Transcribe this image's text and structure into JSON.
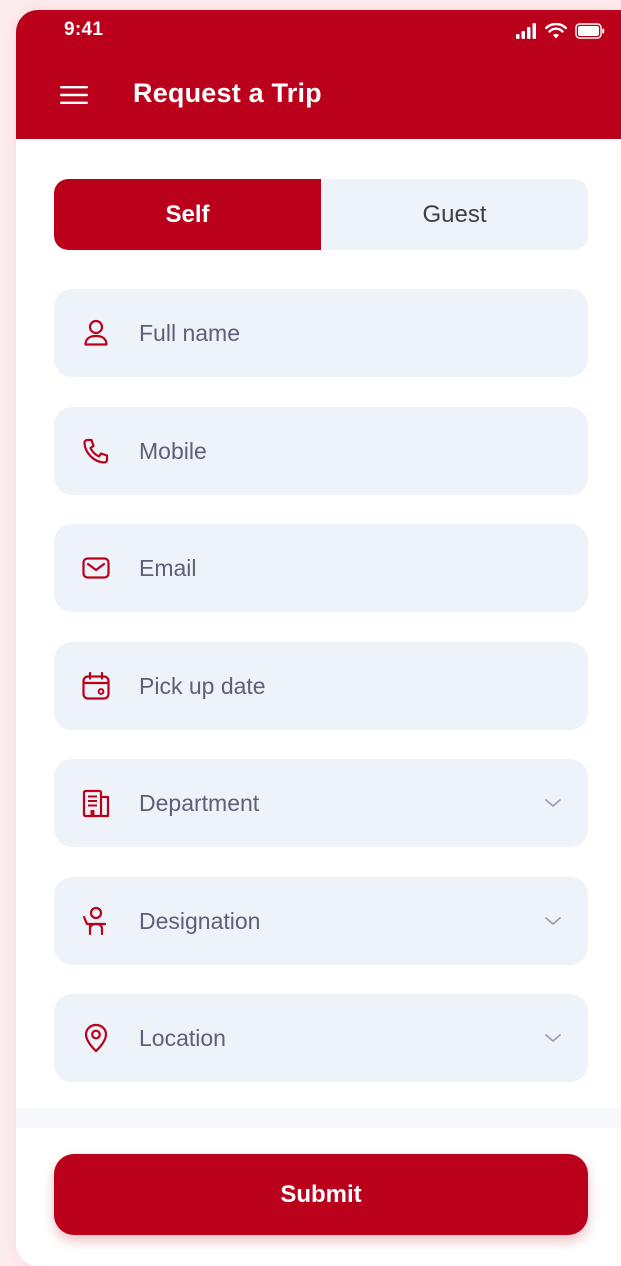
{
  "status_bar": {
    "time": "9:41"
  },
  "header": {
    "title": "Request a Trip"
  },
  "tabs": [
    {
      "label": "Self",
      "active": true
    },
    {
      "label": "Guest",
      "active": false
    }
  ],
  "fields": [
    {
      "placeholder": "Full name",
      "icon": "user-icon",
      "dropdown": false
    },
    {
      "placeholder": "Mobile",
      "icon": "phone-icon",
      "dropdown": false
    },
    {
      "placeholder": "Email",
      "icon": "mail-icon",
      "dropdown": false
    },
    {
      "placeholder": "Pick up date",
      "icon": "calendar-icon",
      "dropdown": false
    },
    {
      "placeholder": "Department",
      "icon": "building-icon",
      "dropdown": true
    },
    {
      "placeholder": "Designation",
      "icon": "person-desk-icon",
      "dropdown": true
    },
    {
      "placeholder": "Location",
      "icon": "location-pin-icon",
      "dropdown": true
    }
  ],
  "submit_label": "Submit",
  "colors": {
    "brand": "#bb001b",
    "field_bg": "#eef3f9",
    "placeholder": "#5b6178"
  }
}
